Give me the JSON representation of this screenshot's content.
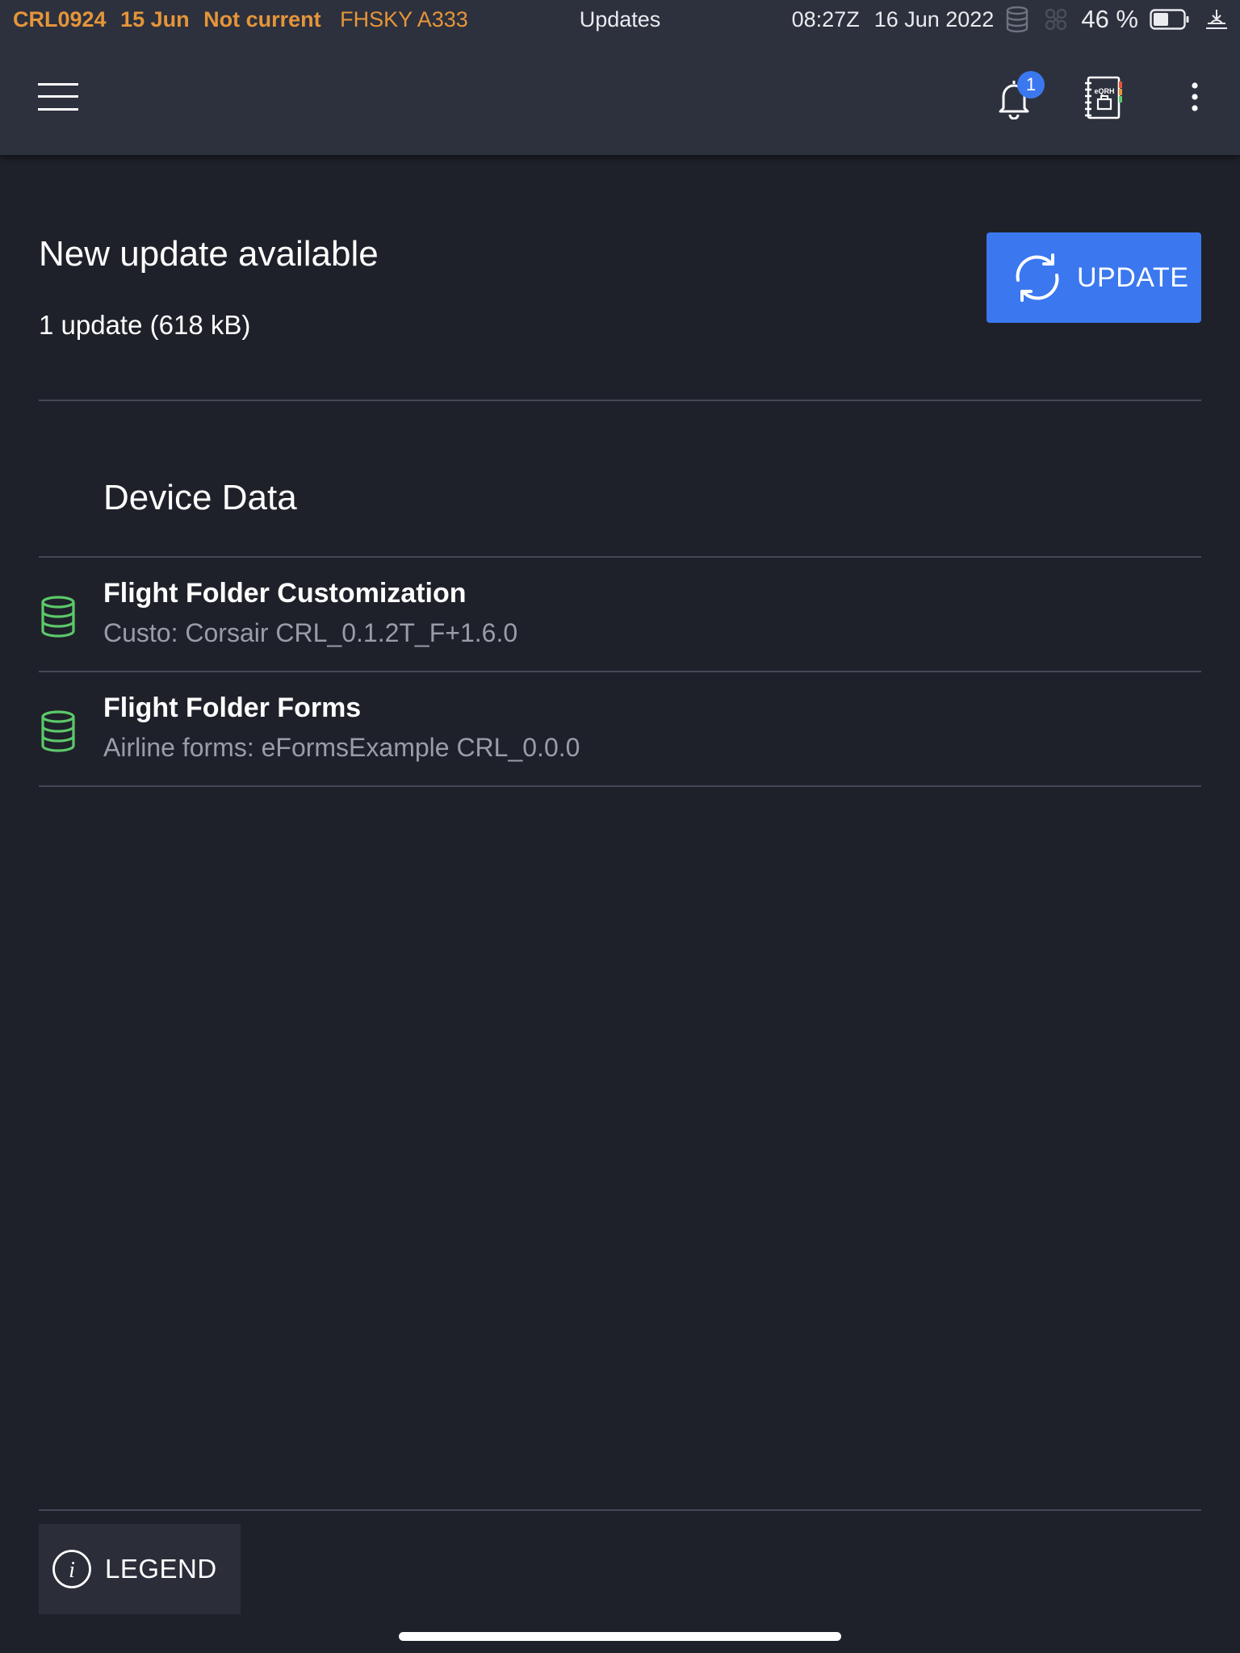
{
  "status_bar": {
    "flight": "CRL0924",
    "flight_date": "15 Jun",
    "currency": "Not current",
    "aircraft": "FHSKY A333",
    "screen_title": "Updates",
    "utc_time": "08:27Z",
    "date": "16 Jun 2022",
    "battery": "46 %"
  },
  "toolbar": {
    "notification_count": "1",
    "eqrh_label": "eQRH"
  },
  "update": {
    "title": "New update available",
    "summary": "1 update (618 kB)",
    "button_label": "UPDATE"
  },
  "device_data": {
    "section_title": "Device Data",
    "items": [
      {
        "name": "Flight Folder Customization",
        "description": "Custo: Corsair CRL_0.1.2T_F+1.6.0"
      },
      {
        "name": "Flight Folder Forms",
        "description": "Airline forms: eFormsExample CRL_0.0.0"
      }
    ]
  },
  "legend": {
    "label": "LEGEND"
  },
  "colors": {
    "background": "#1f212a",
    "header": "#2d313d",
    "accent_blue": "#3b78f0",
    "warning_orange": "#e5953a",
    "db_green": "#5cc96a",
    "secondary_text": "#9a9da8"
  }
}
